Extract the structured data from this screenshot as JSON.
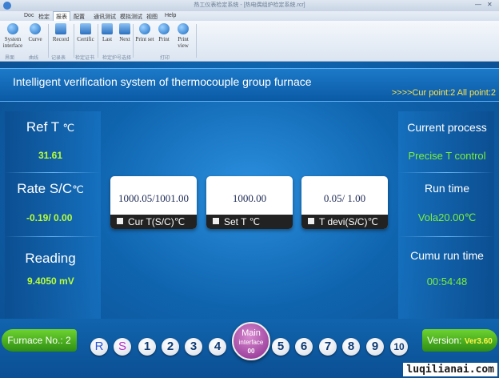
{
  "window": {
    "title": "热工仪表检定系统 - [热电偶组炉检定系统.rcr]",
    "minimize": "—",
    "close": "✕"
  },
  "menu": [
    "Doc",
    "检定",
    "报表",
    "配置",
    "通讯测试",
    "模拟测试",
    "视图",
    "Help"
  ],
  "menu_active_index": 2,
  "ribbon": {
    "buttons": [
      {
        "label": "System interface",
        "icon": "system-interface-icon"
      },
      {
        "label": "Curve",
        "icon": "curve-icon"
      },
      {
        "label": "Record",
        "icon": "record-icon"
      },
      {
        "label": "Certific",
        "icon": "certificate-icon"
      },
      {
        "label": "Last",
        "icon": "last-icon"
      },
      {
        "label": "Next",
        "icon": "next-icon"
      },
      {
        "label": "Print set",
        "icon": "print-set-icon"
      },
      {
        "label": "Print",
        "icon": "print-icon"
      },
      {
        "label": "Print view",
        "icon": "print-view-icon"
      }
    ],
    "groups": [
      "界面",
      "曲线",
      "记录表",
      "检定证书",
      "检定炉号选择",
      "打印"
    ]
  },
  "header": {
    "title": "Intelligent verification system of thermocouple group furnace",
    "cur_point": ">>>>Cur point:2  All point:2"
  },
  "left": {
    "ref_t": {
      "label": "Ref T",
      "unit": "℃",
      "value": "31.61"
    },
    "rate": {
      "label": "Rate S/C",
      "unit": "℃",
      "value": "-0.19/ 0.00"
    },
    "reading": {
      "label": "Reading",
      "value": "9.4050 mV"
    }
  },
  "right": {
    "process": {
      "label": "Current process",
      "value": "Precise T control"
    },
    "run_time": {
      "label": "Run time",
      "value": "Vola20.00℃"
    },
    "cumu": {
      "label": "Cumu run time",
      "value": "00:54:48"
    }
  },
  "cards": [
    {
      "value": "1000.05/1001.00",
      "label": "Cur T(S/C)℃"
    },
    {
      "value": "1000.00",
      "label": "Set T  ℃"
    },
    {
      "value": "0.05/ 1.00",
      "label": "T devi(S/C)℃"
    }
  ],
  "bottom": {
    "furnace": "Furnace No.: 2",
    "version_label": "Version:",
    "version_value": "Ver3.60",
    "main_line1": "Main",
    "main_line2": "interface",
    "main_line3": "00",
    "balls": [
      "R",
      "S",
      "1",
      "2",
      "3",
      "4",
      "5",
      "6",
      "7",
      "8",
      "9",
      "10"
    ]
  },
  "watermark": "luqilianai.com"
}
